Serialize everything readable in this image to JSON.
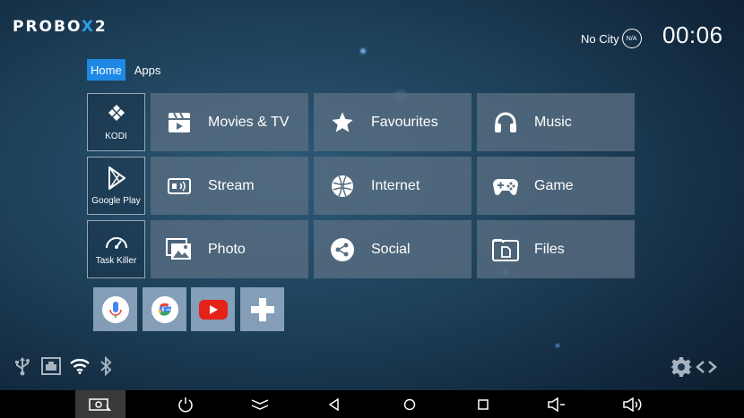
{
  "brand": {
    "prefix": "PROBO",
    "x": "X",
    "suffix": "2"
  },
  "weather": {
    "city": "No City",
    "badge": "N/A"
  },
  "clock": "00:06",
  "tabs": [
    {
      "label": "Home",
      "active": true
    },
    {
      "label": "Apps",
      "active": false
    }
  ],
  "side_apps": [
    {
      "label": "KODI",
      "icon": "kodi-icon"
    },
    {
      "label": "Google Play",
      "icon": "google-play-icon"
    },
    {
      "label": "Task Killer",
      "icon": "speedometer-icon"
    }
  ],
  "grid": [
    {
      "label": "Movies & TV",
      "icon": "clapperboard-icon"
    },
    {
      "label": "Favourites",
      "icon": "star-icon"
    },
    {
      "label": "Music",
      "icon": "headphones-icon"
    },
    {
      "label": "Stream",
      "icon": "cast-icon"
    },
    {
      "label": "Internet",
      "icon": "globe-icon"
    },
    {
      "label": "Game",
      "icon": "gamepad-icon"
    },
    {
      "label": "Photo",
      "icon": "photos-icon"
    },
    {
      "label": "Social",
      "icon": "share-icon"
    },
    {
      "label": "Files",
      "icon": "file-icon"
    }
  ],
  "shortcuts": [
    {
      "icon": "microphone-icon"
    },
    {
      "icon": "google-icon"
    },
    {
      "icon": "youtube-icon"
    },
    {
      "icon": "add-icon"
    }
  ],
  "status_icons": [
    "usb-icon",
    "ethernet-icon",
    "wifi-icon",
    "bluetooth-icon"
  ],
  "navbar": [
    "screenshot-icon",
    "power-icon",
    "collapse-icon",
    "back-icon",
    "home-icon",
    "recents-icon",
    "volume-down-icon",
    "volume-up-icon"
  ],
  "colors": {
    "accent": "#1e88e5",
    "tile": "#5a6e82",
    "youtube": "#e62117"
  }
}
